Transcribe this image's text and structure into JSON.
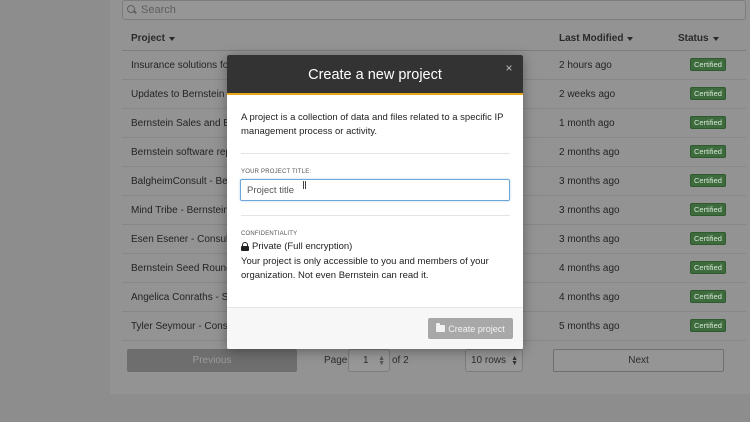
{
  "search": {
    "placeholder": "Search"
  },
  "table": {
    "headers": {
      "project": "Project",
      "last_modified": "Last Modified",
      "status": "Status"
    },
    "rows": [
      {
        "project": "Insurance solutions for",
        "modified": "2 hours ago",
        "status": "Certified"
      },
      {
        "project": "Updates to Bernstein s",
        "modified": "2 weeks ago",
        "status": "Certified"
      },
      {
        "project": "Bernstein Sales and Bu",
        "modified": "1 month ago",
        "status": "Certified"
      },
      {
        "project": "Bernstein software rep",
        "modified": "2 months ago",
        "status": "Certified"
      },
      {
        "project": "BalgheimConsult - Bern",
        "modified": "3 months ago",
        "status": "Certified"
      },
      {
        "project": "Mind Tribe - Bernstein",
        "modified": "3 months ago",
        "status": "Certified"
      },
      {
        "project": "Esen Esener - Consulti",
        "modified": "3 months ago",
        "status": "Certified"
      },
      {
        "project": "Bernstein Seed Round",
        "modified": "4 months ago",
        "status": "Certified"
      },
      {
        "project": "Angelica Conraths - Sh",
        "modified": "4 months ago",
        "status": "Certified"
      },
      {
        "project": "Tyler Seymour - Consul",
        "modified": "5 months ago",
        "status": "Certified"
      }
    ]
  },
  "pager": {
    "previous": "Previous",
    "page_label": "Page",
    "page_value": "1",
    "of_label": "of 2",
    "rows_value": "10 rows",
    "next": "Next"
  },
  "modal": {
    "title": "Create a new project",
    "close": "×",
    "description": "A project is a collection of data and files related to a specific IP management process or activity.",
    "title_field_label": "YOUR PROJECT TITLE:",
    "title_placeholder": "Project title",
    "confidentiality_label": "CONFIDENTIALITY",
    "confidentiality_value": "Private (Full encryption)",
    "confidentiality_desc": "Your project is only accessible to you and members of your organization. Not even Bernstein can read it.",
    "create_button": "Create project"
  },
  "colors": {
    "header_bg": "#333333",
    "accent": "#e6a817",
    "badge": "#3d6b3d",
    "disabled_button": "#a8a8a8",
    "input_focus": "#6ea6d8"
  },
  "icons": [
    "search-icon",
    "sort-caret-icon",
    "close-icon",
    "lock-icon",
    "folder-icon",
    "spinner-icon"
  ]
}
